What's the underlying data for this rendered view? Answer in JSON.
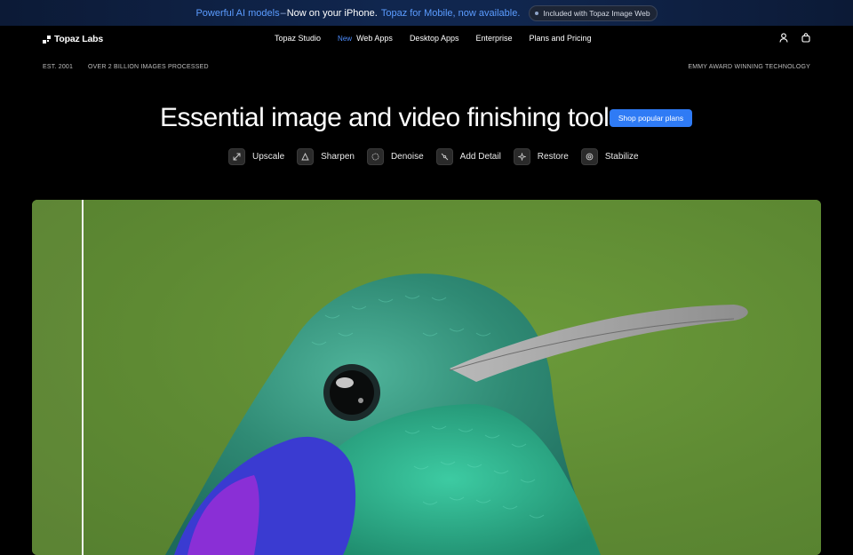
{
  "announcement": {
    "part1": "Powerful AI models",
    "dash": "–",
    "part2": "Now on your iPhone.",
    "part3": "Topaz for Mobile, now available.",
    "badge": "Included with Topaz Image Web"
  },
  "nav": {
    "logo": "Topaz Labs",
    "items": [
      {
        "label": "Topaz Studio"
      },
      {
        "label": "Web Apps",
        "tag": "New"
      },
      {
        "label": "Desktop Apps"
      },
      {
        "label": "Enterprise"
      },
      {
        "label": "Plans and Pricing"
      }
    ],
    "icons": [
      "account-icon",
      "cart-icon"
    ]
  },
  "stats": {
    "established": "EST. 2001",
    "processed": "OVER 2 BILLION IMAGES PROCESSED",
    "award": "EMMY AWARD WINNING TECHNOLOGY"
  },
  "hero": {
    "title": "Essential image and video finishing tools.",
    "cta": "Shop popular plans"
  },
  "tools": [
    {
      "label": "Upscale",
      "icon": "upscale-icon"
    },
    {
      "label": "Sharpen",
      "icon": "sharpen-icon"
    },
    {
      "label": "Denoise",
      "icon": "denoise-icon"
    },
    {
      "label": "Add Detail",
      "icon": "add-detail-icon"
    },
    {
      "label": "Restore",
      "icon": "restore-icon"
    },
    {
      "label": "Stabilize",
      "icon": "stabilize-icon"
    }
  ],
  "colors": {
    "accent": "#2f7bf5",
    "announcement_link": "#5b9cff",
    "background": "#000000",
    "image_green": "#5f8c35"
  }
}
